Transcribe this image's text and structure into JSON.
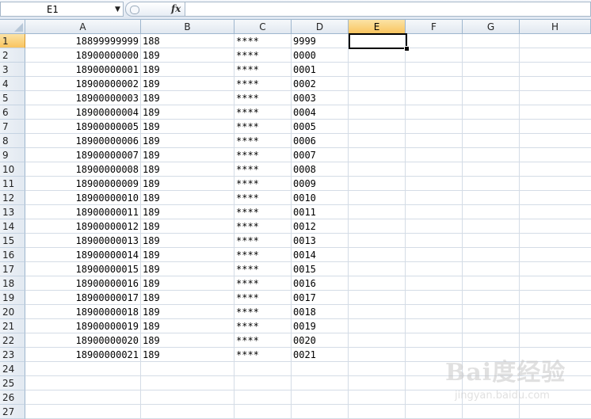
{
  "formula_bar": {
    "name_box": "E1",
    "fx_label": "fx",
    "formula": ""
  },
  "columns": [
    "A",
    "B",
    "C",
    "D",
    "E",
    "F",
    "G",
    "H"
  ],
  "active_column": "E",
  "active_row": 1,
  "rows": [
    {
      "n": "1",
      "a": "18899999999",
      "b": "188",
      "c": "****",
      "d": "9999"
    },
    {
      "n": "2",
      "a": "18900000000",
      "b": "189",
      "c": "****",
      "d": "0000"
    },
    {
      "n": "3",
      "a": "18900000001",
      "b": "189",
      "c": "****",
      "d": "0001"
    },
    {
      "n": "4",
      "a": "18900000002",
      "b": "189",
      "c": "****",
      "d": "0002"
    },
    {
      "n": "5",
      "a": "18900000003",
      "b": "189",
      "c": "****",
      "d": "0003"
    },
    {
      "n": "6",
      "a": "18900000004",
      "b": "189",
      "c": "****",
      "d": "0004"
    },
    {
      "n": "7",
      "a": "18900000005",
      "b": "189",
      "c": "****",
      "d": "0005"
    },
    {
      "n": "8",
      "a": "18900000006",
      "b": "189",
      "c": "****",
      "d": "0006"
    },
    {
      "n": "9",
      "a": "18900000007",
      "b": "189",
      "c": "****",
      "d": "0007"
    },
    {
      "n": "10",
      "a": "18900000008",
      "b": "189",
      "c": "****",
      "d": "0008"
    },
    {
      "n": "11",
      "a": "18900000009",
      "b": "189",
      "c": "****",
      "d": "0009"
    },
    {
      "n": "12",
      "a": "18900000010",
      "b": "189",
      "c": "****",
      "d": "0010"
    },
    {
      "n": "13",
      "a": "18900000011",
      "b": "189",
      "c": "****",
      "d": "0011"
    },
    {
      "n": "14",
      "a": "18900000012",
      "b": "189",
      "c": "****",
      "d": "0012"
    },
    {
      "n": "15",
      "a": "18900000013",
      "b": "189",
      "c": "****",
      "d": "0013"
    },
    {
      "n": "16",
      "a": "18900000014",
      "b": "189",
      "c": "****",
      "d": "0014"
    },
    {
      "n": "17",
      "a": "18900000015",
      "b": "189",
      "c": "****",
      "d": "0015"
    },
    {
      "n": "18",
      "a": "18900000016",
      "b": "189",
      "c": "****",
      "d": "0016"
    },
    {
      "n": "19",
      "a": "18900000017",
      "b": "189",
      "c": "****",
      "d": "0017"
    },
    {
      "n": "20",
      "a": "18900000018",
      "b": "189",
      "c": "****",
      "d": "0018"
    },
    {
      "n": "21",
      "a": "18900000019",
      "b": "189",
      "c": "****",
      "d": "0019"
    },
    {
      "n": "22",
      "a": "18900000020",
      "b": "189",
      "c": "****",
      "d": "0020"
    },
    {
      "n": "23",
      "a": "18900000021",
      "b": "189",
      "c": "****",
      "d": "0021"
    },
    {
      "n": "24",
      "a": "",
      "b": "",
      "c": "",
      "d": ""
    },
    {
      "n": "25",
      "a": "",
      "b": "",
      "c": "",
      "d": ""
    },
    {
      "n": "26",
      "a": "",
      "b": "",
      "c": "",
      "d": ""
    },
    {
      "n": "27",
      "a": "",
      "b": "",
      "c": "",
      "d": ""
    }
  ],
  "watermark": {
    "text": "Bai度经验",
    "sub": "jingyan.baidu.com"
  }
}
